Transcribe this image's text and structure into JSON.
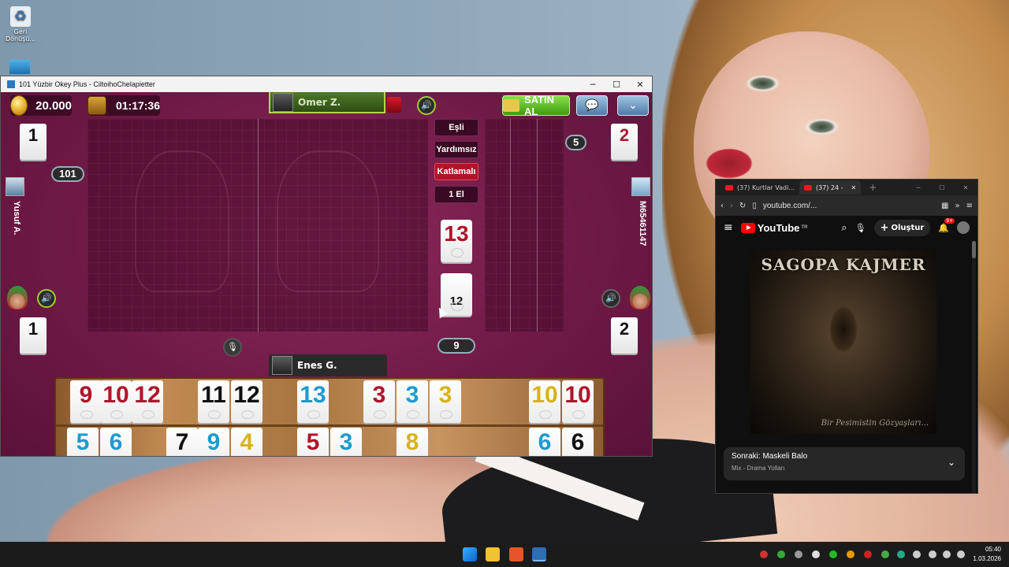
{
  "desktop": {
    "recycle_bin_label": "Geri Dönüşü...",
    "icons": [
      "recycle-bin-icon",
      "app-shortcut-icon"
    ]
  },
  "game_window": {
    "title": "101 Yüzbir Okey Plus - CiltoihoChelapietter",
    "controls": [
      "─",
      "☐",
      "✕"
    ],
    "coins": "20.000",
    "timer": "01:17:36",
    "buy_label": "SATIN AL",
    "top_player": "Omer Z.",
    "left_player": "Yusuf A.",
    "right_player": "M65461147",
    "bottom_player": "Enes G.",
    "options": [
      "Eşli",
      "Yardımsız",
      "Katlamalı",
      "1 El"
    ],
    "active_option": "Katlamalı",
    "score_101": "101",
    "remaining_badge": "5",
    "pile_count": "9",
    "corner_tiles": {
      "top_left": "1",
      "top_right": "2",
      "bottom_left": "1",
      "bottom_right": "2"
    },
    "indicator_tile": "13",
    "discard_tile": "12",
    "rack_row1": [
      {
        "v": "9",
        "c": "red"
      },
      {
        "v": "10",
        "c": "red"
      },
      {
        "v": "12",
        "c": "red"
      },
      {
        "v": "11",
        "c": "black"
      },
      {
        "v": "12",
        "c": "black"
      },
      {
        "v": "13",
        "c": "blue"
      },
      {
        "v": "3",
        "c": "red"
      },
      {
        "v": "3",
        "c": "blue"
      },
      {
        "v": "3",
        "c": "yellow"
      },
      {
        "v": "10",
        "c": "yellow"
      },
      {
        "v": "10",
        "c": "red"
      }
    ],
    "rack_row2": [
      {
        "v": "5",
        "c": "blue"
      },
      {
        "v": "6",
        "c": "blue"
      },
      {
        "v": "7",
        "c": "black"
      },
      {
        "v": "9",
        "c": "blue"
      },
      {
        "v": "4",
        "c": "yellow"
      },
      {
        "v": "5",
        "c": "red"
      },
      {
        "v": "3",
        "c": "blue"
      },
      {
        "v": "8",
        "c": "yellow"
      },
      {
        "v": "6",
        "c": "blue"
      },
      {
        "v": "6",
        "c": "black"
      }
    ],
    "colors": {
      "red": "#b0142a",
      "black": "#111111",
      "blue": "#1a9bd0",
      "yellow": "#d8b21a",
      "felt": "#6f1a46"
    }
  },
  "browser": {
    "tabs": [
      "(37) Kurtlar Vadi...",
      "(37) 24 - "
    ],
    "url": "youtube.com/...",
    "yt_logo": "YouTube",
    "yt_region": "TR",
    "create_label": "Oluştur",
    "notif_count": "9+",
    "video_title": "SAGOPA KAJMER",
    "video_subtitle": "Bir Pesimistin Gözyaşları...",
    "next_label": "Sonraki: Maskeli Balo",
    "next_sub": "Mix - Drama Yolları"
  },
  "taskbar": {
    "time": "05:40",
    "date": "1.03.2026"
  }
}
